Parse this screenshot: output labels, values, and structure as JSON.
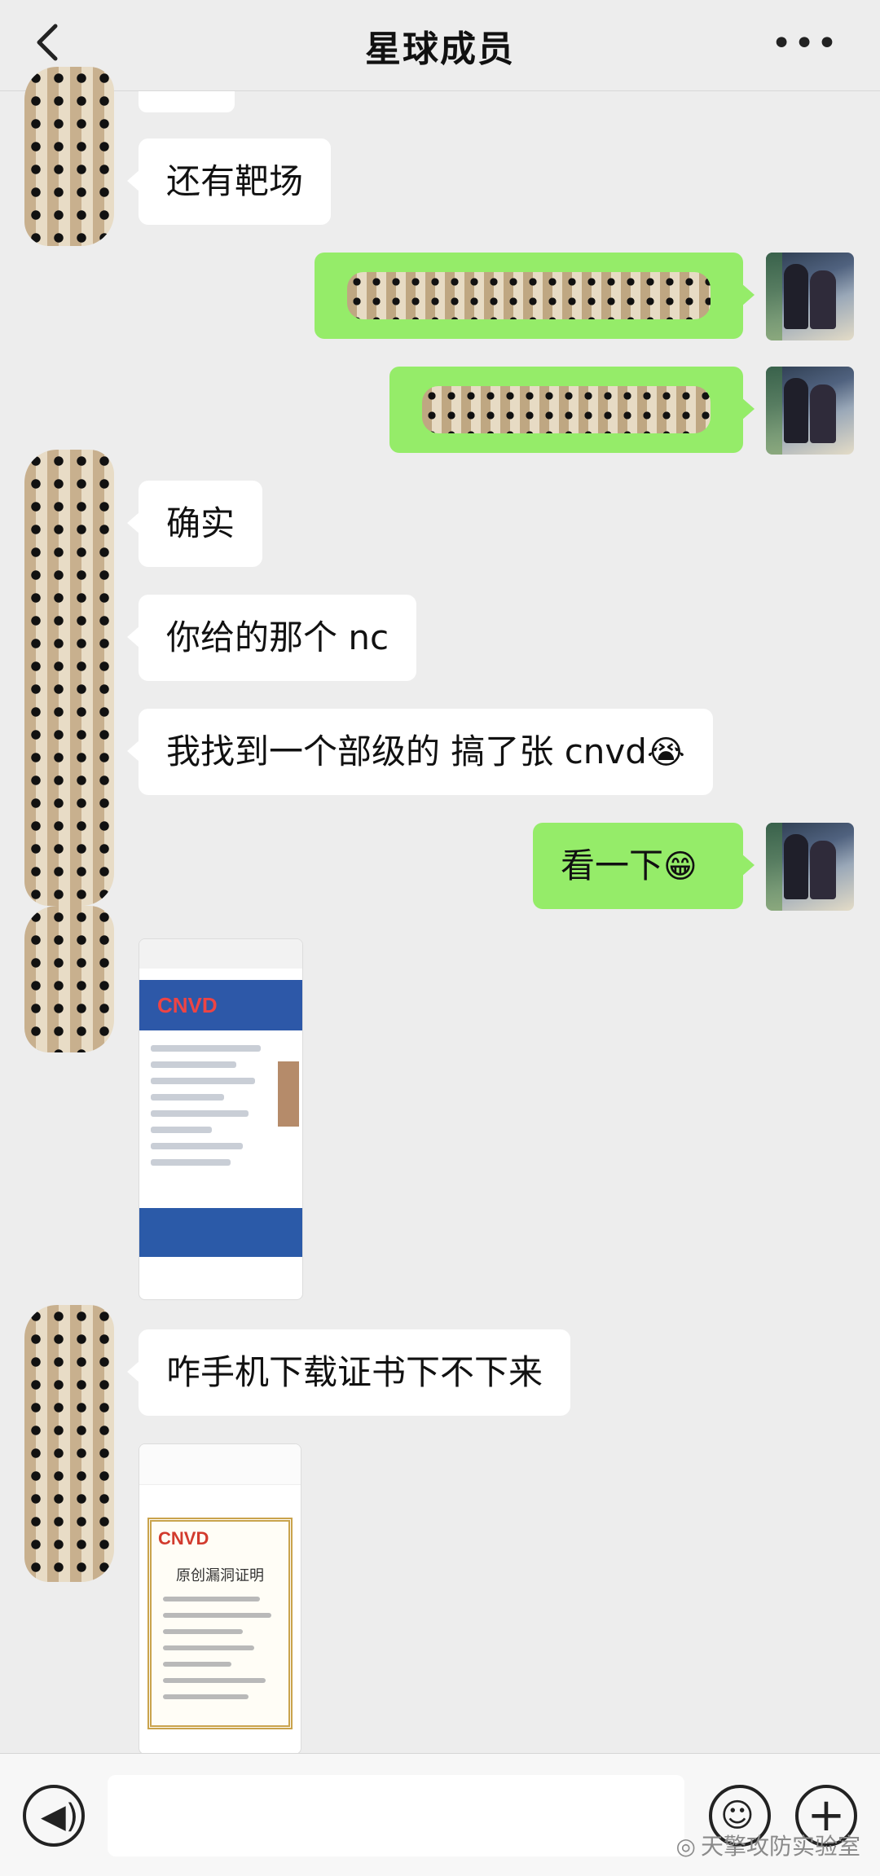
{
  "header": {
    "title": "星球成员",
    "back_icon": "chevron-left-icon",
    "more_label": "•••"
  },
  "messages": [
    {
      "side": "left",
      "text": "还有靶场"
    },
    {
      "side": "right",
      "text": "",
      "redacted": true
    },
    {
      "side": "right",
      "text": "",
      "redacted": true
    },
    {
      "side": "left",
      "text": "确实"
    },
    {
      "side": "left",
      "text": "你给的那个 nc"
    },
    {
      "side": "left",
      "text": "我找到一个部级的 搞了张 cnvd",
      "emoji": "😭"
    },
    {
      "side": "right",
      "text": "看一下",
      "emoji": "😁"
    },
    {
      "side": "left",
      "type": "image",
      "logo": "CNVD"
    },
    {
      "side": "left",
      "text": "咋手机下载证书下不下来"
    },
    {
      "side": "left",
      "type": "image",
      "logo": "CNVD",
      "caption": "原创漏洞证明"
    }
  ],
  "input_bar": {
    "voice_icon": "voice-icon",
    "emoji_icon": "emoji-icon",
    "plus_icon": "plus-icon",
    "voice_glyph": "◀)",
    "emoji_glyph": "☺",
    "plus_glyph": "+"
  },
  "watermark": "天擎攻防实验室",
  "colors": {
    "background": "#ededed",
    "bubble_self": "#95ec69",
    "bubble_other": "#ffffff"
  }
}
